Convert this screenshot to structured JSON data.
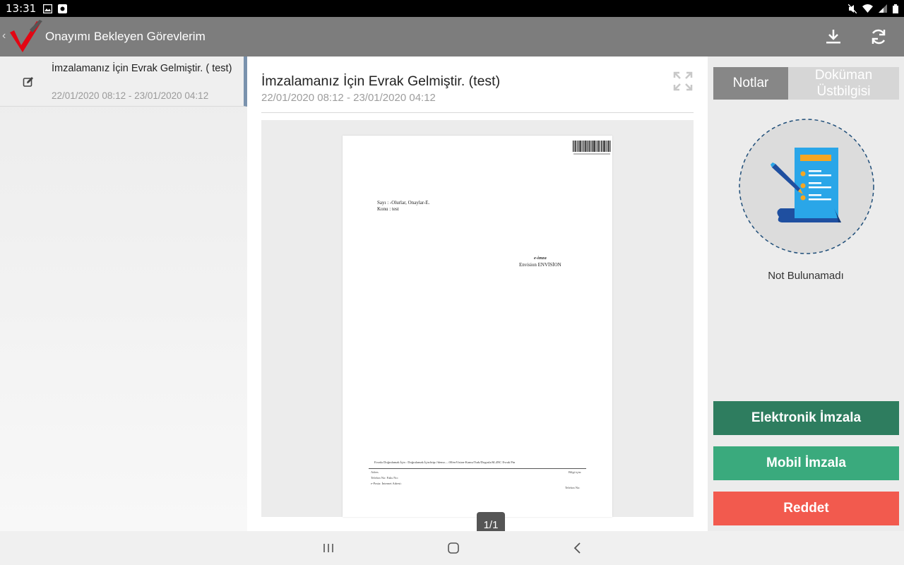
{
  "status_bar": {
    "time": "13:31",
    "left_icons": [
      "image-icon",
      "notification-icon"
    ],
    "right_icons": [
      "mute-icon",
      "wifi-icon",
      "signal-icon",
      "battery-icon"
    ]
  },
  "app_bar": {
    "title": "Onayımı Bekleyen Görevlerim",
    "actions": [
      "download-icon",
      "refresh-icon"
    ],
    "logo_colors": {
      "check": "#e30613",
      "slash": "#555555"
    }
  },
  "task_list": [
    {
      "title": "İmzalamanız İçin Evrak Gelmiştir. ( test)",
      "date": "22/01/2020 08:12 - 23/01/2020 04:12",
      "icon": "edit-icon",
      "selected": true
    }
  ],
  "document": {
    "title": "İmzalamanız İçin Evrak Gelmiştir. (test)",
    "date": "22/01/2020 08:12 - 23/01/2020 04:12",
    "page_indicator": "1/1",
    "page": {
      "sayi": "Sayı    : -Olurlar, Onaylar-E.",
      "konu": "Konu   : test",
      "imza": "e-imza",
      "signer": "Envision ENVİSİON",
      "footer": "Evrakı Doğrulamak İçin : Doğrulamak İçin:http://demo.....00/enVision-Kamu/Turk/Dogrula/6L4NC    Evrak Pin",
      "adres": "Adres",
      "telefon": "Telefon No:   Faks No:",
      "eposta": "e-Posta:   İnternet Adresi:",
      "bilgi": "Bilgi için:",
      "telno": "Telefon No:"
    }
  },
  "right_panel": {
    "tabs": [
      {
        "label": "Notlar",
        "active": true
      },
      {
        "label": "Doküman Üstbilgisi",
        "active": false
      }
    ],
    "empty_text": "Not Bulunamadı",
    "buttons": {
      "electronic_sign": "Elektronik İmzala",
      "mobile_sign": "Mobil İmzala",
      "reject": "Reddet"
    },
    "colors": {
      "electronic_sign": "#2e7d5f",
      "mobile_sign": "#3aaa7d",
      "reject": "#f25a4e"
    }
  },
  "nav_bar": {
    "buttons": [
      "recents-icon",
      "home-icon",
      "back-icon"
    ]
  }
}
